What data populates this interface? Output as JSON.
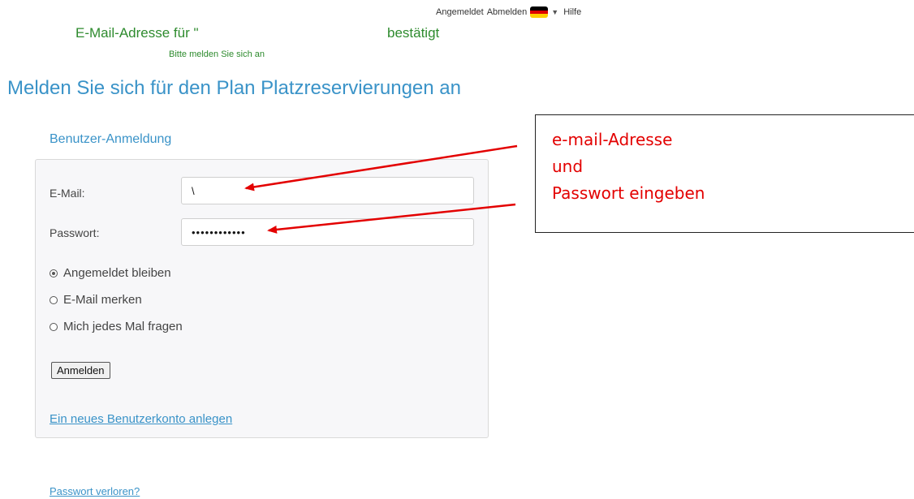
{
  "header": {
    "top_cut_text": "",
    "logged_in": "Angemeldet",
    "logout": "Abmelden",
    "language_flag": "german-flag-icon",
    "help": "Hilfe"
  },
  "confirmation": {
    "prefix": "E-Mail-Adresse für \"",
    "suffix": "bestätigt",
    "hint": "Bitte melden Sie sich an"
  },
  "page_title": "Melden Sie sich für den Plan Platzreservierungen an",
  "login": {
    "section_title": "Benutzer-Anmeldung",
    "email_label": "E-Mail:",
    "email_value": "\\",
    "password_label": "Passwort:",
    "password_value": "••••••••••••",
    "options": [
      {
        "label": "Angemeldet bleiben",
        "checked": true
      },
      {
        "label": "E-Mail merken",
        "checked": false
      },
      {
        "label": "Mich jedes Mal fragen",
        "checked": false
      }
    ],
    "submit_label": "Anmelden",
    "create_account_link": "Ein neues Benutzerkonto anlegen"
  },
  "lost_password_link": "Passwort verloren?",
  "annotation": {
    "line1": "e-mail-Adresse",
    "line2": "und",
    "line3": "Passwort eingeben",
    "color": "#e30000"
  },
  "colors": {
    "heading_blue": "#3a93c8",
    "confirm_green": "#2e8b2e",
    "panel_bg": "#f7f7f9"
  }
}
